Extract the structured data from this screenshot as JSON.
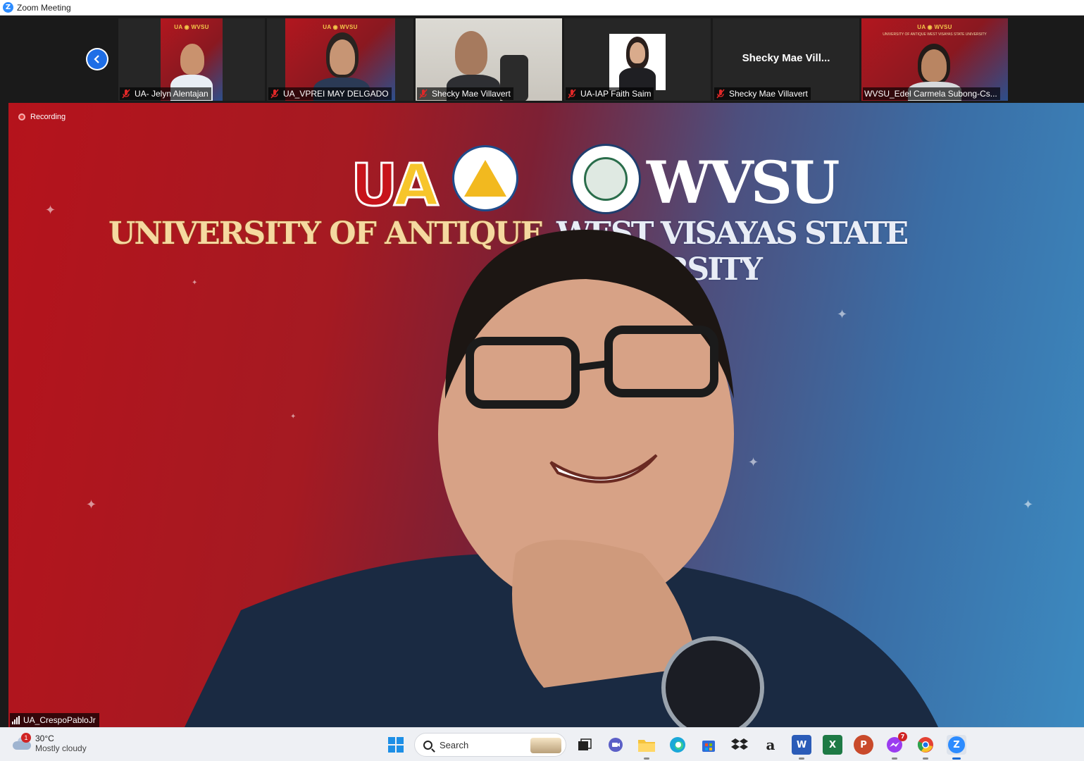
{
  "window": {
    "title": "Zoom Meeting",
    "app_icon": "zoom-icon"
  },
  "gallery": {
    "participants": [
      {
        "name": "UA- Jelyn Alentajan",
        "muted": true,
        "background": "UA WVSU banner"
      },
      {
        "name": "UA_VPREI MAY DELGADO",
        "muted": true,
        "background": "UA WVSU banner"
      },
      {
        "name": "Shecky Mae Villavert",
        "muted": true,
        "background": "office room"
      },
      {
        "name": "UA-IAP Faith Saim",
        "muted": true,
        "background": "photo"
      },
      {
        "name": "Shecky Mae Villavert",
        "muted": true,
        "video_off": true,
        "display_name": "Shecky  Mae  Vill..."
      },
      {
        "name": "WVSU_Edel Carmela Subong-Cs...",
        "muted": false,
        "active_speaker_highlight": true,
        "background": "UA WVSU banner"
      }
    ],
    "mini_banner_left": "UA",
    "mini_banner_right": "WVSU",
    "mini_banner_sub": "UNIVERSITY OF ANTIQUE   WEST VISAYAS STATE UNIVERSITY"
  },
  "main_video": {
    "recording_label": "Recording",
    "speaker_name": "UA_CrespoPabloJr",
    "background": {
      "logo_left_u": "U",
      "logo_left_a": "A",
      "logo_right": "WVSU",
      "university_left": "UNIVERSITY OF ANTIQUE",
      "university_right": "WEST VISAYAS STATE UNIVERSITY"
    }
  },
  "taskbar": {
    "weather": {
      "temp": "30°C",
      "condition": "Mostly cloudy",
      "badge": "1"
    },
    "search_placeholder": "Search",
    "apps": [
      {
        "icon": "task-view-icon"
      },
      {
        "icon": "teams-meet-icon"
      },
      {
        "icon": "file-explorer-icon"
      },
      {
        "icon": "edge-icon"
      },
      {
        "icon": "store-icon"
      },
      {
        "icon": "dropbox-icon"
      },
      {
        "icon": "amazon-icon",
        "label": "a"
      },
      {
        "icon": "word-icon",
        "label": "W"
      },
      {
        "icon": "excel-icon",
        "label": "X"
      },
      {
        "icon": "powerpoint-icon",
        "label": "P"
      },
      {
        "icon": "messenger-icon",
        "badge": "7"
      },
      {
        "icon": "chrome-icon"
      },
      {
        "icon": "zoom-taskbar-icon",
        "label": "Z",
        "active": true
      }
    ]
  },
  "colors": {
    "zoom_blue": "#2d8cff",
    "active_outline": "#a4c93a",
    "mute_red": "#e02828"
  }
}
